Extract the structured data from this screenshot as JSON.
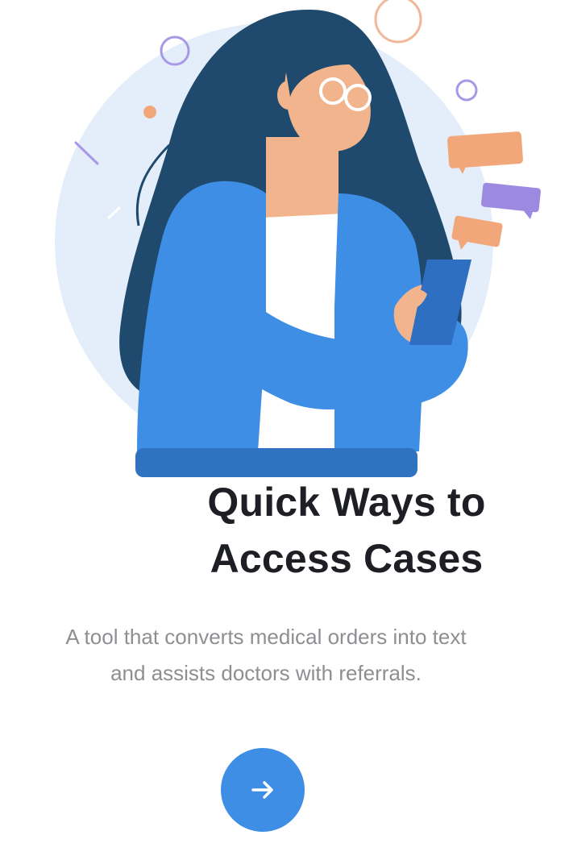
{
  "onboarding": {
    "title_line1": "Quick Ways to",
    "title_line2": "Access Cases",
    "description": "A tool that converts medical orders into text and assists doctors with referrals.",
    "next_button": {
      "icon": "arrow-right-icon"
    }
  },
  "illustration": {
    "subject": "woman-with-phone-illustration",
    "colors": {
      "background_circle": "#e3eefa",
      "hair": "#1f4a6e",
      "skin": "#f2b48c",
      "jacket": "#3e8ee6",
      "jacket_shadow": "#2f72c0",
      "chat_bubble_orange": "#f1a77a",
      "chat_bubble_purple": "#9c8ae0",
      "phone": "#2e6fc2"
    }
  },
  "theme": {
    "accent": "#3e8ee6",
    "title_color": "#1d1f24",
    "body_color": "#8e8e93"
  }
}
